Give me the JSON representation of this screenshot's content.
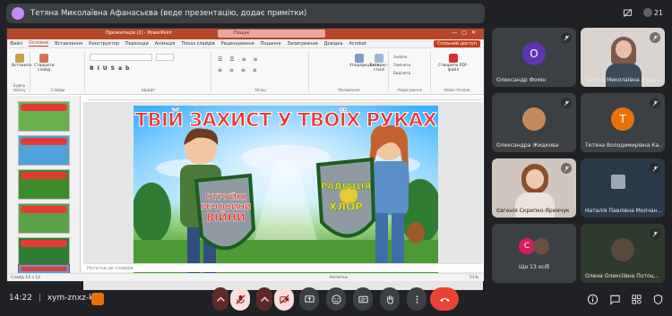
{
  "meeting": {
    "presenter_label": "Тетяна Миколаївна Афанасьєва (веде презентацію, додає примітки)",
    "participant_count": "21",
    "time": "14:22",
    "meeting_code": "xym-znxz-ktv"
  },
  "powerpoint": {
    "window_title": "Презентація (2) - PowerPoint",
    "search_placeholder": "Пошук",
    "menu_tabs": [
      "Файл",
      "Основне",
      "Вставлення",
      "Конструктор",
      "Переходи",
      "Анімація",
      "Показ слайдів",
      "Рецензування",
      "Подання",
      "Записування",
      "Довідка",
      "Acrobat"
    ],
    "active_tab": "Основне",
    "share_button": "Спільний доступ",
    "ribbon_groups": {
      "clipboard": "Буфер обміну",
      "slides": "Слайди",
      "font": "Шрифт",
      "paragraph": "Абзац",
      "drawing": "Малювання",
      "editing": "Редагування",
      "acrobat": "Adobe Acrobat"
    },
    "ribbon_buttons": {
      "paste": "Вставити",
      "new_slide": "Створити слайд",
      "arrange": "Упорядкувати",
      "quick_styles": "Експрес-стилі",
      "find": "Знайти",
      "replace": "Замінити",
      "select": "Виділити",
      "create_pdf": "Створити PDF-файл"
    },
    "thumbnails": [
      {
        "number": "9",
        "title": "ПРОСТИЙ СЛАЙД"
      },
      {
        "number": "10",
        "title": "ВОГНИК"
      },
      {
        "number": "11",
        "title": "ЗАХИСНІ ЗАСОБИ"
      },
      {
        "number": "12",
        "title": "ЗАСОБИ ЗАХИСТУ"
      },
      {
        "number": "13",
        "title": "ЗАХИСНІ ЗАСОБИ"
      },
      {
        "number": "14",
        "title": "ТВІЙ ЗАХИСТ У ТВОЇХ РУКАХ"
      }
    ],
    "slide": {
      "title": "ТВІЙ ЗАХИСТ У ТВОЇХ РУКАХ",
      "left_shield": [
        "ОТРУЙНІ",
        "РЕЧОВИНИ",
        "ВІЙНИ"
      ],
      "right_shield": [
        "РАДІАЦІЯ",
        "ХЛОР"
      ]
    },
    "notes_placeholder": "Нотатки до слайдів",
    "status_left": "Слайд 14 з 14",
    "status_notes": "Нотатки",
    "status_zoom": "51%"
  },
  "participants": [
    {
      "name": "Олександр Фомін",
      "initial": "О",
      "color": "#5e35b1"
    },
    {
      "name": "Тетяна Миколаївна Афана...",
      "initial": "",
      "color": ""
    },
    {
      "name": "Олександра Жидкова",
      "initial": "",
      "color": ""
    },
    {
      "name": "Тетяна Володимирівна Ка...",
      "initial": "Т",
      "color": "#e8710a"
    },
    {
      "name": "Євгенія Скрипко-Яремчук",
      "initial": "",
      "color": ""
    },
    {
      "name": "Наталія Павлівна Молчан...",
      "initial": "",
      "color": ""
    },
    {
      "name": "Ще 13 осіб",
      "initial": "С",
      "color": "#d81b60"
    },
    {
      "name": "Олена Олексіївна Потоц...",
      "initial": "",
      "color": ""
    }
  ]
}
